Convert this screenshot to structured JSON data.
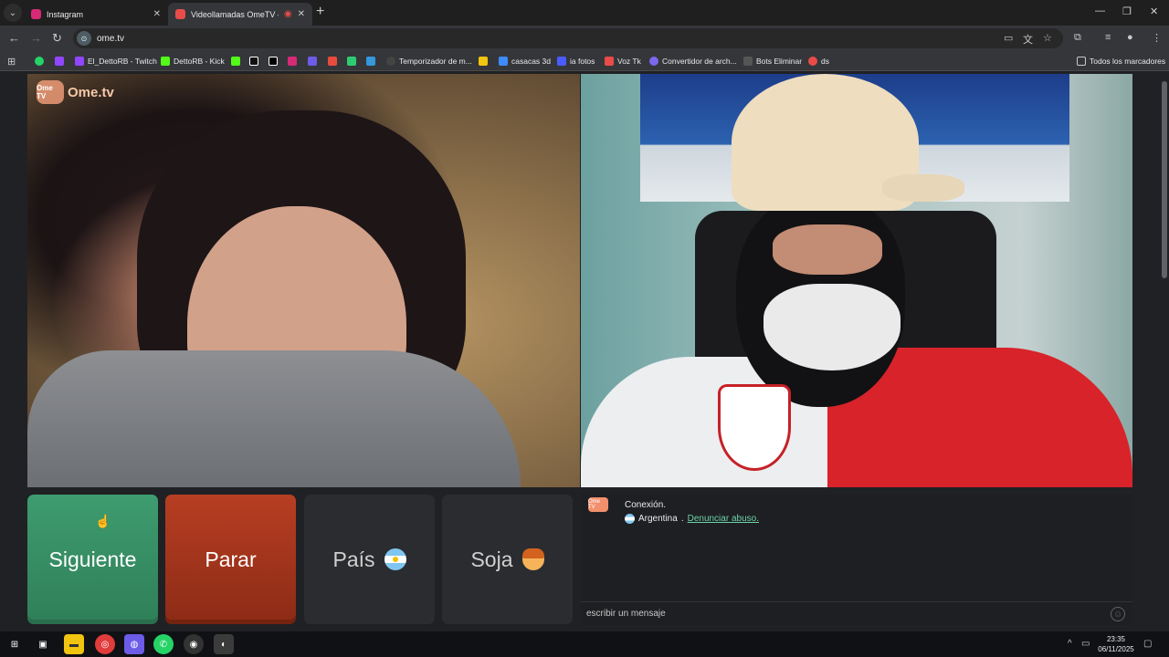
{
  "browser": {
    "tabs": [
      {
        "title": "Instagram",
        "favicon_color": "#d62976"
      },
      {
        "title": "Videollamadas OmeTV — ",
        "favicon_color": "#e94c48"
      }
    ],
    "url": "ome.tv",
    "bookmarks": [
      {
        "label": "",
        "icon": "whatsapp-icon",
        "color": "#25d366"
      },
      {
        "label": "",
        "icon": "twitch-icon",
        "color": "#9146ff"
      },
      {
        "label": "El_DettoRB - Twitch",
        "icon": "twitch-icon",
        "color": "#9146ff"
      },
      {
        "label": "DettoRB - Kick",
        "icon": "kick-icon",
        "color": "#53fc18"
      },
      {
        "label": "",
        "icon": "kick-icon",
        "color": "#53fc18"
      },
      {
        "label": "",
        "icon": "tiktok-icon",
        "color": "#ffffff"
      },
      {
        "label": "",
        "icon": "x-icon",
        "color": "#ffffff"
      },
      {
        "label": "",
        "icon": "instagram-icon",
        "color": "#d62976"
      },
      {
        "label": "",
        "icon": "app-icon",
        "color": "#6c5ce7"
      },
      {
        "label": "",
        "icon": "app-icon",
        "color": "#e74c3c"
      },
      {
        "label": "",
        "icon": "app-icon",
        "color": "#2ecc71"
      },
      {
        "label": "",
        "icon": "app-icon",
        "color": "#3498db"
      },
      {
        "label": "Temporizador de m...",
        "icon": "timer-icon",
        "color": "#222222"
      },
      {
        "label": "",
        "icon": "folder-icon",
        "color": "#f1c40f"
      },
      {
        "label": "casacas 3d",
        "icon": "image-icon",
        "color": "#3d8bfd"
      },
      {
        "label": "ia fotos",
        "icon": "ai-icon",
        "color": "#4a5cff"
      },
      {
        "label": "Voz Tk",
        "icon": "voice-icon",
        "color": "#e94c48"
      },
      {
        "label": "Convertidor de arch...",
        "icon": "convert-icon",
        "color": "#7b68ee"
      },
      {
        "label": "Bots Eliminar",
        "icon": "bot-icon",
        "color": "#333333"
      },
      {
        "label": "ds",
        "icon": "app-icon",
        "color": "#e94c48"
      }
    ],
    "all_bookmarks": "Todos los marcadores"
  },
  "app": {
    "logo": "Ome.tv",
    "logo_mark": "Ome TV",
    "buttons": {
      "next": "Siguiente",
      "stop": "Parar",
      "country": "País",
      "gender": "Soja"
    },
    "chat": {
      "status": "Conexión.",
      "country": "Argentina",
      "separator": ".",
      "abuse_link": "Denunciar abuso.",
      "input_placeholder": "escribir un mensaje"
    }
  },
  "taskbar": {
    "time": "23:35",
    "date": "06/11/2025"
  }
}
